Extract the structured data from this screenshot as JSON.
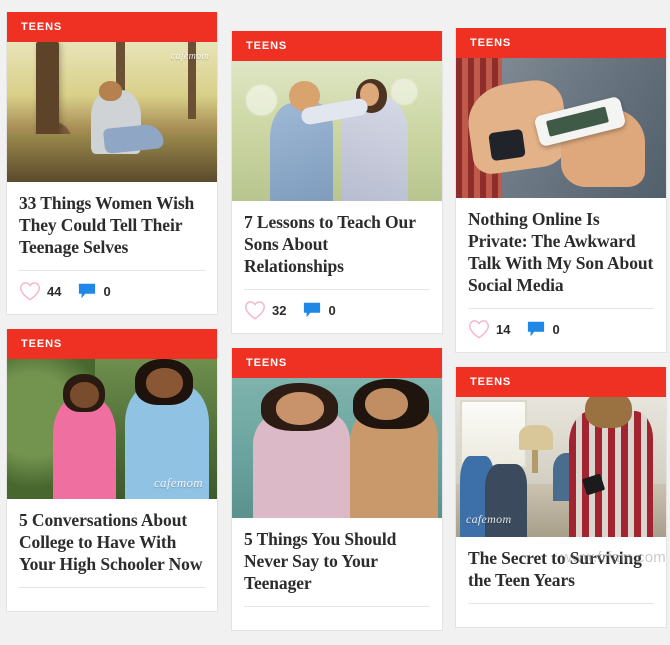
{
  "site": {
    "watermark": "www.frfam.com",
    "photo_credit": "cafemom",
    "background_color": "#f1f1f1",
    "banner_color": "#ef3124",
    "heart_color": "#f4b6cd",
    "comment_color": "#1f87e5"
  },
  "columns": [
    {
      "id": "column-1",
      "cards": [
        {
          "category": "TEENS",
          "title": "33 Things Women Wish They Could Tell Their Teenage Selves",
          "likes": "44",
          "comments": "0",
          "image_alt": "Teen girl sitting against a tree in a forest",
          "credit": "cafemom"
        },
        {
          "category": "TEENS",
          "title": "5 Conversations About College to Have With Your High Schooler Now",
          "likes": "",
          "comments": "",
          "image_alt": "Mother talking with her teenage daughter outdoors",
          "credit": "cafemom"
        }
      ]
    },
    {
      "id": "column-2",
      "cards": [
        {
          "category": "TEENS",
          "title": "7 Lessons to Teach Our Sons About Relationships",
          "likes": "32",
          "comments": "0",
          "image_alt": "Teenage couple embracing forehead to forehead",
          "credit": ""
        },
        {
          "category": "TEENS",
          "title": "5 Things You Should Never Say to Your Teenager",
          "likes": "",
          "comments": "",
          "image_alt": "Mother and teen daughter smiling on a couch",
          "credit": ""
        }
      ]
    },
    {
      "id": "column-3",
      "cards": [
        {
          "category": "TEENS",
          "title": "Nothing Online Is Private: The Awkward Talk With My Son About Social Media",
          "likes": "14",
          "comments": "0",
          "image_alt": "Hands holding and tapping a white smartphone",
          "credit": ""
        },
        {
          "category": "TEENS",
          "title": "The Secret to Surviving the Teen Years",
          "likes": "",
          "comments": "",
          "image_alt": "Teens sitting in a living room looking at phones",
          "credit": "cafemom"
        }
      ]
    }
  ]
}
